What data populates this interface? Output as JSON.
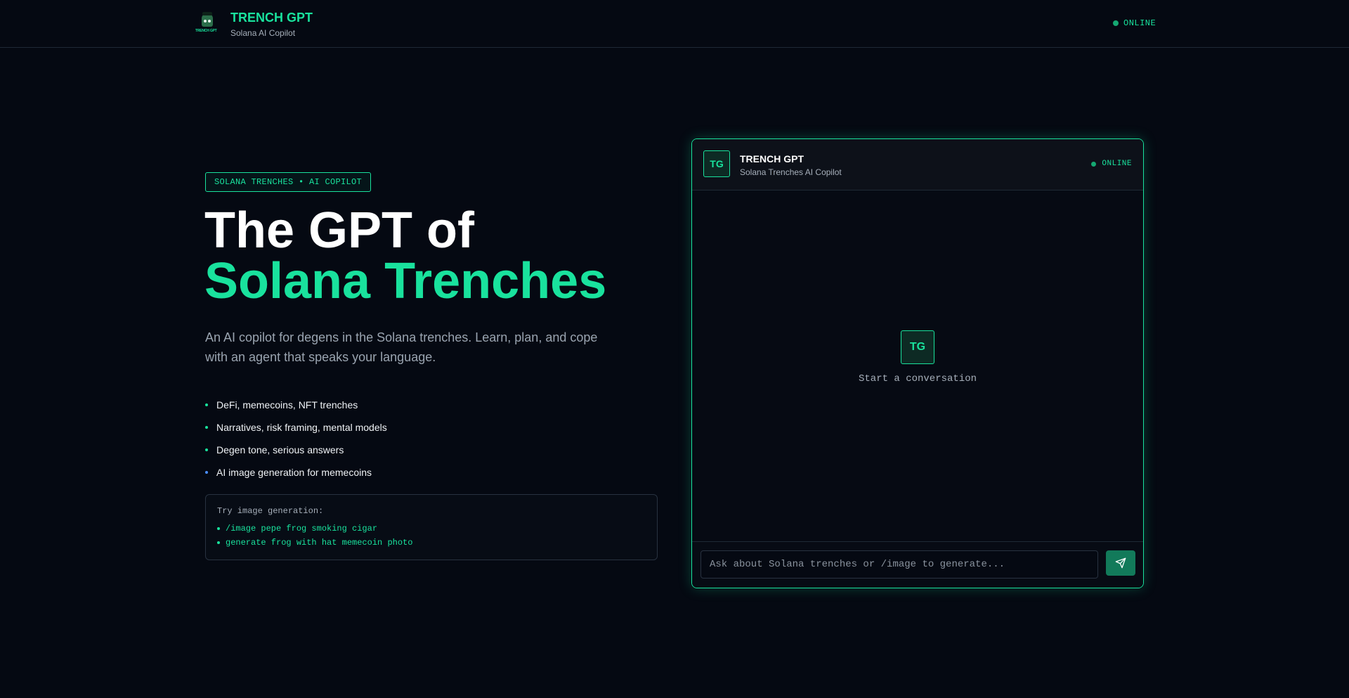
{
  "header": {
    "logo_text": "TRENCH GPT",
    "title": "TRENCH GPT",
    "subtitle": "Solana AI Copilot",
    "status": "ONLINE"
  },
  "hero": {
    "tagline": "SOLANA TRENCHES • AI COPILOT",
    "title_plain": "The GPT of ",
    "title_accent": "Solana Trenches",
    "description": "An AI copilot for degens in the Solana trenches. Learn, plan, and cope with an agent that speaks your language.",
    "features": [
      "DeFi, memecoins, NFT trenches",
      "Narratives, risk framing, mental models",
      "Degen tone, serious answers",
      "AI image generation for memecoins"
    ],
    "examples": {
      "title": "Try image generation:",
      "items": [
        "/image pepe frog smoking cigar",
        "generate frog with hat memecoin photo"
      ]
    }
  },
  "chat": {
    "avatar": "TG",
    "title": "TRENCH GPT",
    "subtitle": "Solana Trenches AI Copilot",
    "status": "ONLINE",
    "empty_avatar": "TG",
    "empty_text": "Start a conversation",
    "input_placeholder": "Ask about Solana trenches or /image to generate...",
    "send_icon": "send-icon"
  },
  "colors": {
    "accent": "#19e29d",
    "background": "#050912",
    "feature_bullet_last": "#4a8fff"
  }
}
